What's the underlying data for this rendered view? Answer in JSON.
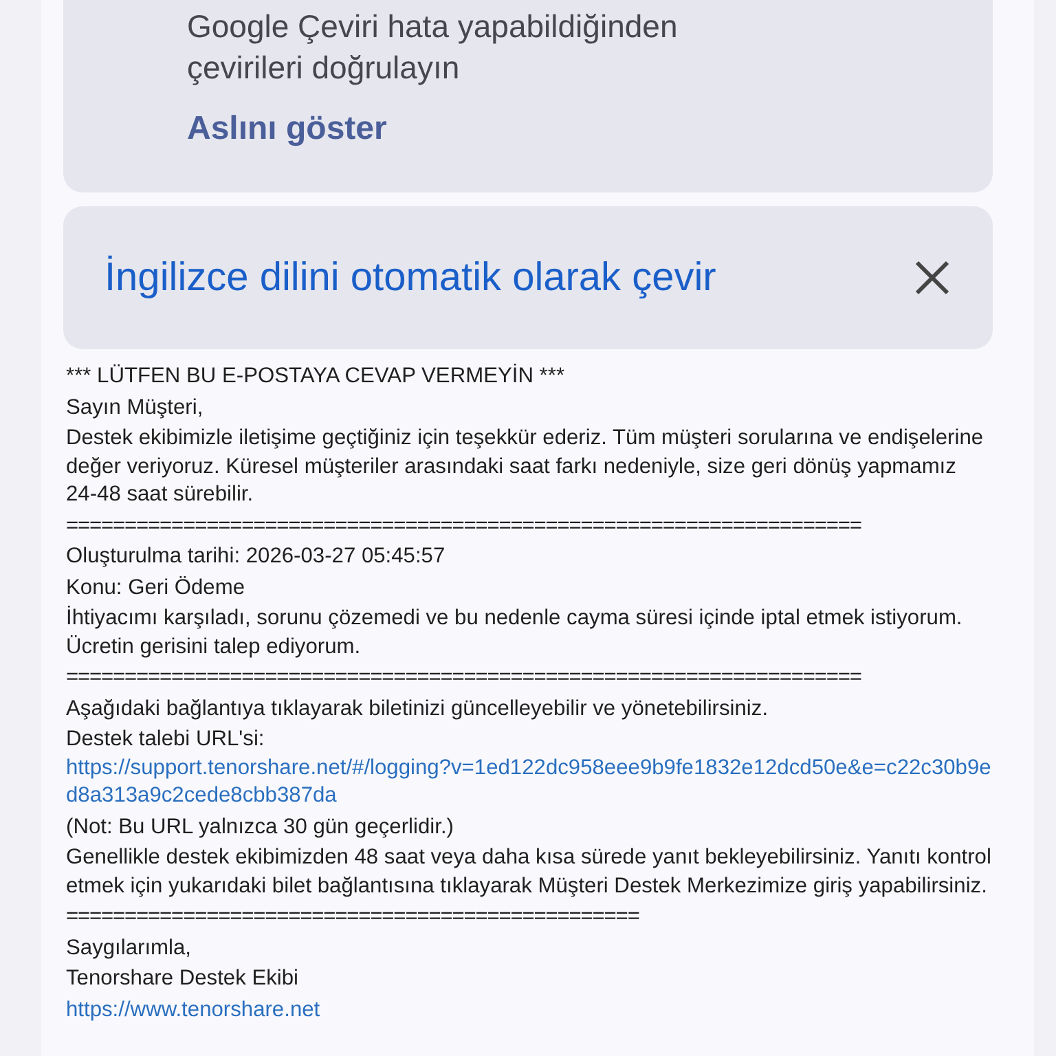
{
  "translate_notice": {
    "warning": "Google Çeviri hata yapabildiğinden çevirileri doğrulayın",
    "show_original": "Aslını göster"
  },
  "auto_translate": {
    "label": "İngilizce dilini otomatik olarak çevir"
  },
  "email": [
    {
      "kind": "text",
      "text": "*** LÜTFEN BU E-POSTAYA CEVAP VERMEYİN ***"
    },
    {
      "kind": "text",
      "text": "Sayın Müşteri,"
    },
    {
      "kind": "text",
      "text": "Destek ekibimizle iletişime geçtiğiniz için teşekkür ederiz. Tüm müşteri sorularına ve endişelerine değer veriyoruz. Küresel müşteriler arasındaki saat farkı nedeniyle, size geri dönüş yapmamız 24-48 saat sürebilir."
    },
    {
      "kind": "rule",
      "text": "===================================================================="
    },
    {
      "kind": "text",
      "text": "Oluşturulma tarihi: 2026-03-27 05:45:57"
    },
    {
      "kind": "text",
      "text": "Konu: Geri Ödeme"
    },
    {
      "kind": "text",
      "text": "İhtiyacımı karşıladı, sorunu çözemedi ve bu nedenle cayma süresi içinde iptal etmek istiyorum. Ücretin gerisini talep ediyorum."
    },
    {
      "kind": "rule",
      "text": "===================================================================="
    },
    {
      "kind": "text",
      "text": "Aşağıdaki bağlantıya tıklayarak biletinizi güncelleyebilir ve yönetebilirsiniz."
    },
    {
      "kind": "url",
      "text": "Destek talebi URL'si:",
      "link": "https://support.tenorshare.net/#/logging?v=1ed122dc958eee9b9fe1832e12dcd50e&e=c22c30b9ed8a313a9c2cede8cbb387da"
    },
    {
      "kind": "text",
      "text": "(Not: Bu URL yalnızca 30 gün geçerlidir.)"
    },
    {
      "kind": "text",
      "text": "Genellikle destek ekibimizden 48 saat veya daha kısa sürede yanıt bekleyebilirsiniz. Yanıtı kontrol etmek için yukarıdaki bilet bağlantısına tıklayarak Müşteri Destek Merkezimize giriş yapabilirsiniz."
    },
    {
      "kind": "rule",
      "text": "================================================="
    },
    {
      "kind": "text",
      "text": "Saygılarımla,"
    },
    {
      "kind": "text",
      "text": "Tenorshare Destek Ekibi"
    },
    {
      "kind": "link",
      "link": "https://www.tenorshare.net"
    }
  ]
}
